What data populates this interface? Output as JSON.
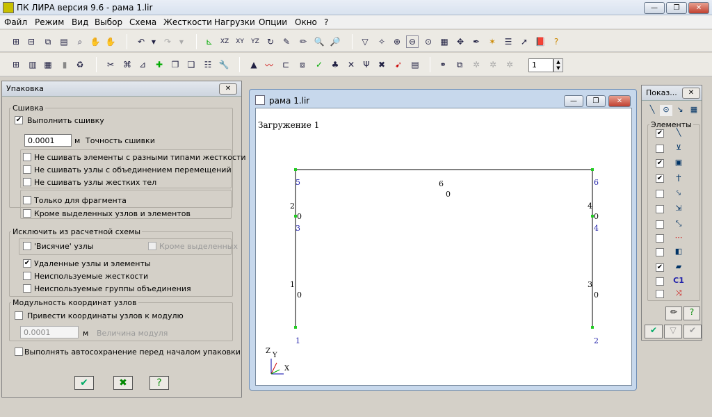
{
  "window": {
    "title": "ПК ЛИРА  версия 9.6 - рама 1.lir"
  },
  "menu": [
    "Файл",
    "Режим",
    "Вид",
    "Выбор",
    "Схема",
    "Жесткости",
    "Нагрузки",
    "Опции",
    "Окно",
    "?"
  ],
  "toolbar2": {
    "spin_value": "1"
  },
  "pack": {
    "title": "Упаковка",
    "g1": "Сшивка",
    "do_stitch": "Выполнить сшивку",
    "tol_value": "0.0001",
    "tol_unit": "м",
    "tol_label": "Точность сшивки",
    "c1": "Не сшивать элементы с разными типами жесткости",
    "c2": "Не сшивать узлы с объединением перемещений",
    "c3": "Не сшивать узлы жестких тел",
    "c4": "Только для фрагмента",
    "c5": "Кроме выделенных узлов и элементов",
    "g2": "Исключить из расчетной схемы",
    "c6": "'Висячие' узлы",
    "c6b": "Кроме выделенных",
    "c7": "Удаленные узлы и элементы",
    "c8": "Неиспользуемые жесткости",
    "c9": "Неиспользуемые группы объединения",
    "g3": "Модульность координат узлов",
    "c10": "Привести координаты узлов к модулю",
    "mod_value": "0.0001",
    "mod_unit": "м",
    "mod_label": "Величина модуля",
    "c11": "Выполнять автосохранение перед началом упаковки",
    "check": {
      "do_stitch": true,
      "c7": true
    }
  },
  "doc": {
    "title": "рама 1.lir",
    "load": "Загружение  1",
    "nodes": [
      {
        "n": "1"
      },
      {
        "n": "2"
      },
      {
        "n": "3"
      },
      {
        "n": "4"
      },
      {
        "n": "5"
      },
      {
        "n": "6"
      }
    ],
    "elements": [
      {
        "n": "1",
        "v": "0"
      },
      {
        "n": "2",
        "v": "0"
      },
      {
        "n": "3",
        "v": "0"
      },
      {
        "n": "4",
        "v": "0"
      },
      {
        "n": "6",
        "v": "0"
      }
    ],
    "axes": {
      "z": "Z",
      "y": "Y",
      "x": "X"
    }
  },
  "show": {
    "title": "Показ...",
    "group": "Элементы",
    "checks": [
      true,
      false,
      true,
      true,
      false,
      false,
      false,
      false,
      false,
      true,
      false,
      false
    ],
    "c1": "C1"
  }
}
